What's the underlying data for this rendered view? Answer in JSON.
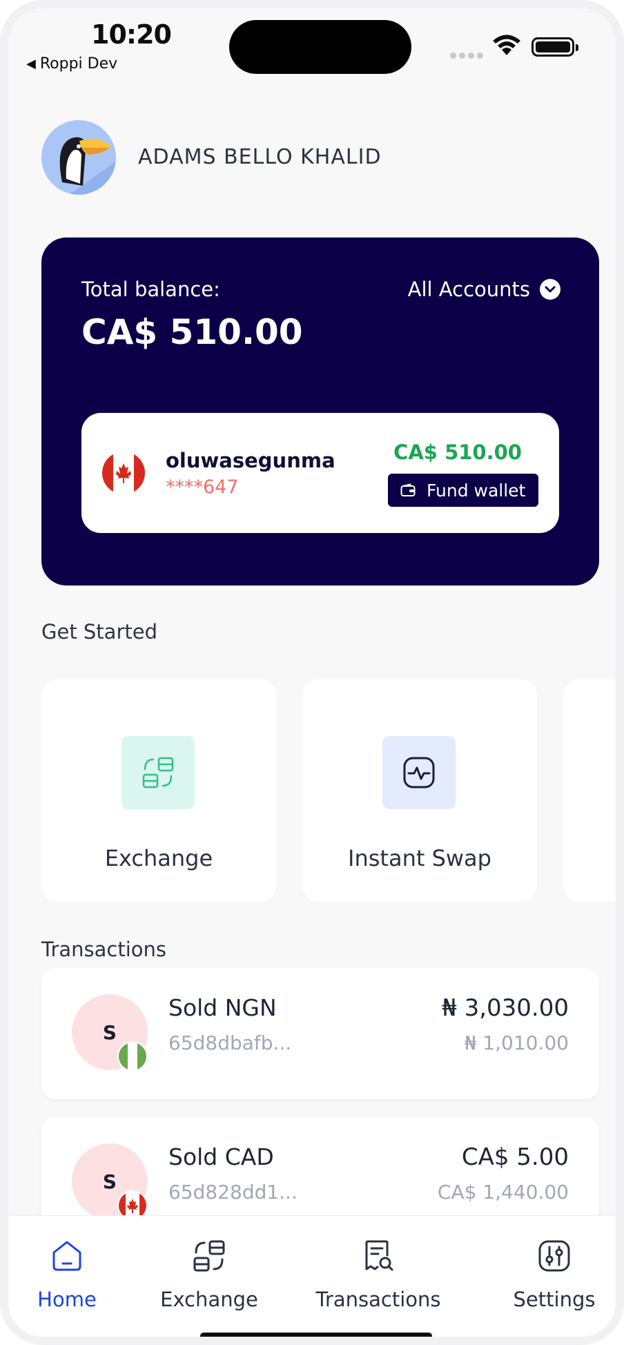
{
  "status_bar": {
    "time": "10:20",
    "back_app": "Roppi Dev",
    "icons": [
      "signal-dots-icon",
      "wifi-icon",
      "battery-icon"
    ]
  },
  "profile": {
    "name": "ADAMS BELLO  KHALID",
    "avatar_icon": "toucan-avatar-icon"
  },
  "balance": {
    "label": "Total balance:",
    "value": "CA$ 510.00",
    "account_selector": "All Accounts"
  },
  "wallet": {
    "name": "oluwasegunma",
    "number": "****647",
    "amount": "CA$ 510.00",
    "fund_label": "Fund wallet",
    "flag_icon": "canada-flag-icon"
  },
  "get_started": {
    "title": "Get Started",
    "cards": [
      {
        "label": "Exchange",
        "icon": "exchange-icon"
      },
      {
        "label": "Instant Swap",
        "icon": "instant-swap-icon"
      }
    ]
  },
  "transactions": {
    "title": "Transactions",
    "items": [
      {
        "initial": "S",
        "title": "Sold NGN",
        "ref": "65d8dbafb...",
        "amount": "₦ 3,030.00",
        "sub_amount": "₦ 1,010.00",
        "flag": "nigeria-flag-icon"
      },
      {
        "initial": "S",
        "title": "Sold CAD",
        "ref": "65d828dd1...",
        "amount": "CA$ 5.00",
        "sub_amount": "CA$ 1,440.00",
        "flag": "canada-flag-icon"
      }
    ]
  },
  "bottom_nav": {
    "items": [
      {
        "label": "Home",
        "icon": "home-icon",
        "active": true
      },
      {
        "label": "Exchange",
        "icon": "exchange-icon"
      },
      {
        "label": "Transactions",
        "icon": "transactions-icon"
      },
      {
        "label": "Settings",
        "icon": "settings-icon"
      }
    ]
  },
  "colors": {
    "card_navy": "#0b0047",
    "accent_blue": "#1a44e8",
    "amount_green": "#1aa652",
    "account_number_red": "#f07067"
  }
}
